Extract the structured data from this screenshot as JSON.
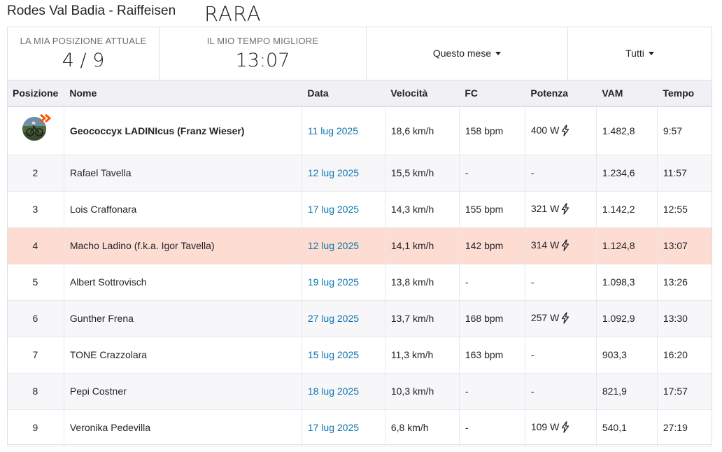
{
  "header": {
    "segment_title": "Rodes Val Badia - Raiffeisen",
    "overlay_text": "RARA"
  },
  "stats": {
    "position_label": "LA MIA POSIZIONE ATTUALE",
    "position_value": "4 / 9",
    "best_time_label": "IL MIO TEMPO MIGLIORE",
    "best_time_value": "13:07",
    "date_filter": "Questo mese",
    "people_filter": "Tutti"
  },
  "columns": {
    "position": "Posizione",
    "name": "Nome",
    "date": "Data",
    "speed": "Velocità",
    "hr": "FC",
    "power": "Potenza",
    "vam": "VAM",
    "time": "Tempo"
  },
  "icons": {
    "power": "lightning-bolt-icon",
    "leader_badge": "crown-chevron-icon"
  },
  "colors": {
    "link": "#0a75ad",
    "highlight_row": "#fddcd2",
    "badge": "#fc5200"
  },
  "rows": [
    {
      "rank": "",
      "name": "Geococcyx LADINIcus (Franz Wieser)",
      "date": "11 lug 2025",
      "speed": "18,6 km/h",
      "hr": "158 bpm",
      "power": "400 W",
      "vam": "1.482,8",
      "time": "9:57"
    },
    {
      "rank": "2",
      "name": "Rafael Tavella",
      "date": "12 lug 2025",
      "speed": "15,5 km/h",
      "hr": "-",
      "power": "-",
      "vam": "1.234,6",
      "time": "11:57"
    },
    {
      "rank": "3",
      "name": "Lois Craffonara",
      "date": "17 lug 2025",
      "speed": "14,3 km/h",
      "hr": "155 bpm",
      "power": "321 W",
      "vam": "1.142,2",
      "time": "12:55"
    },
    {
      "rank": "4",
      "name": "Macho Ladino (f.k.a. Igor Tavella)",
      "date": "12 lug 2025",
      "speed": "14,1 km/h",
      "hr": "142 bpm",
      "power": "314 W",
      "vam": "1.124,8",
      "time": "13:07"
    },
    {
      "rank": "5",
      "name": "Albert Sottrovisch",
      "date": "19 lug 2025",
      "speed": "13,8 km/h",
      "hr": "-",
      "power": "-",
      "vam": "1.098,3",
      "time": "13:26"
    },
    {
      "rank": "6",
      "name": "Gunther Frena",
      "date": "27 lug 2025",
      "speed": "13,7 km/h",
      "hr": "168 bpm",
      "power": "257 W",
      "vam": "1.092,9",
      "time": "13:30"
    },
    {
      "rank": "7",
      "name": "TONE Crazzolara",
      "date": "15 lug 2025",
      "speed": "11,3 km/h",
      "hr": "163 bpm",
      "power": "-",
      "vam": "903,3",
      "time": "16:20"
    },
    {
      "rank": "8",
      "name": "Pepi Costner",
      "date": "18 lug 2025",
      "speed": "10,3 km/h",
      "hr": "-",
      "power": "-",
      "vam": "821,9",
      "time": "17:57"
    },
    {
      "rank": "9",
      "name": "Veronika Pedevilla",
      "date": "17 lug 2025",
      "speed": "6,8 km/h",
      "hr": "-",
      "power": "109 W",
      "vam": "540,1",
      "time": "27:19"
    }
  ]
}
